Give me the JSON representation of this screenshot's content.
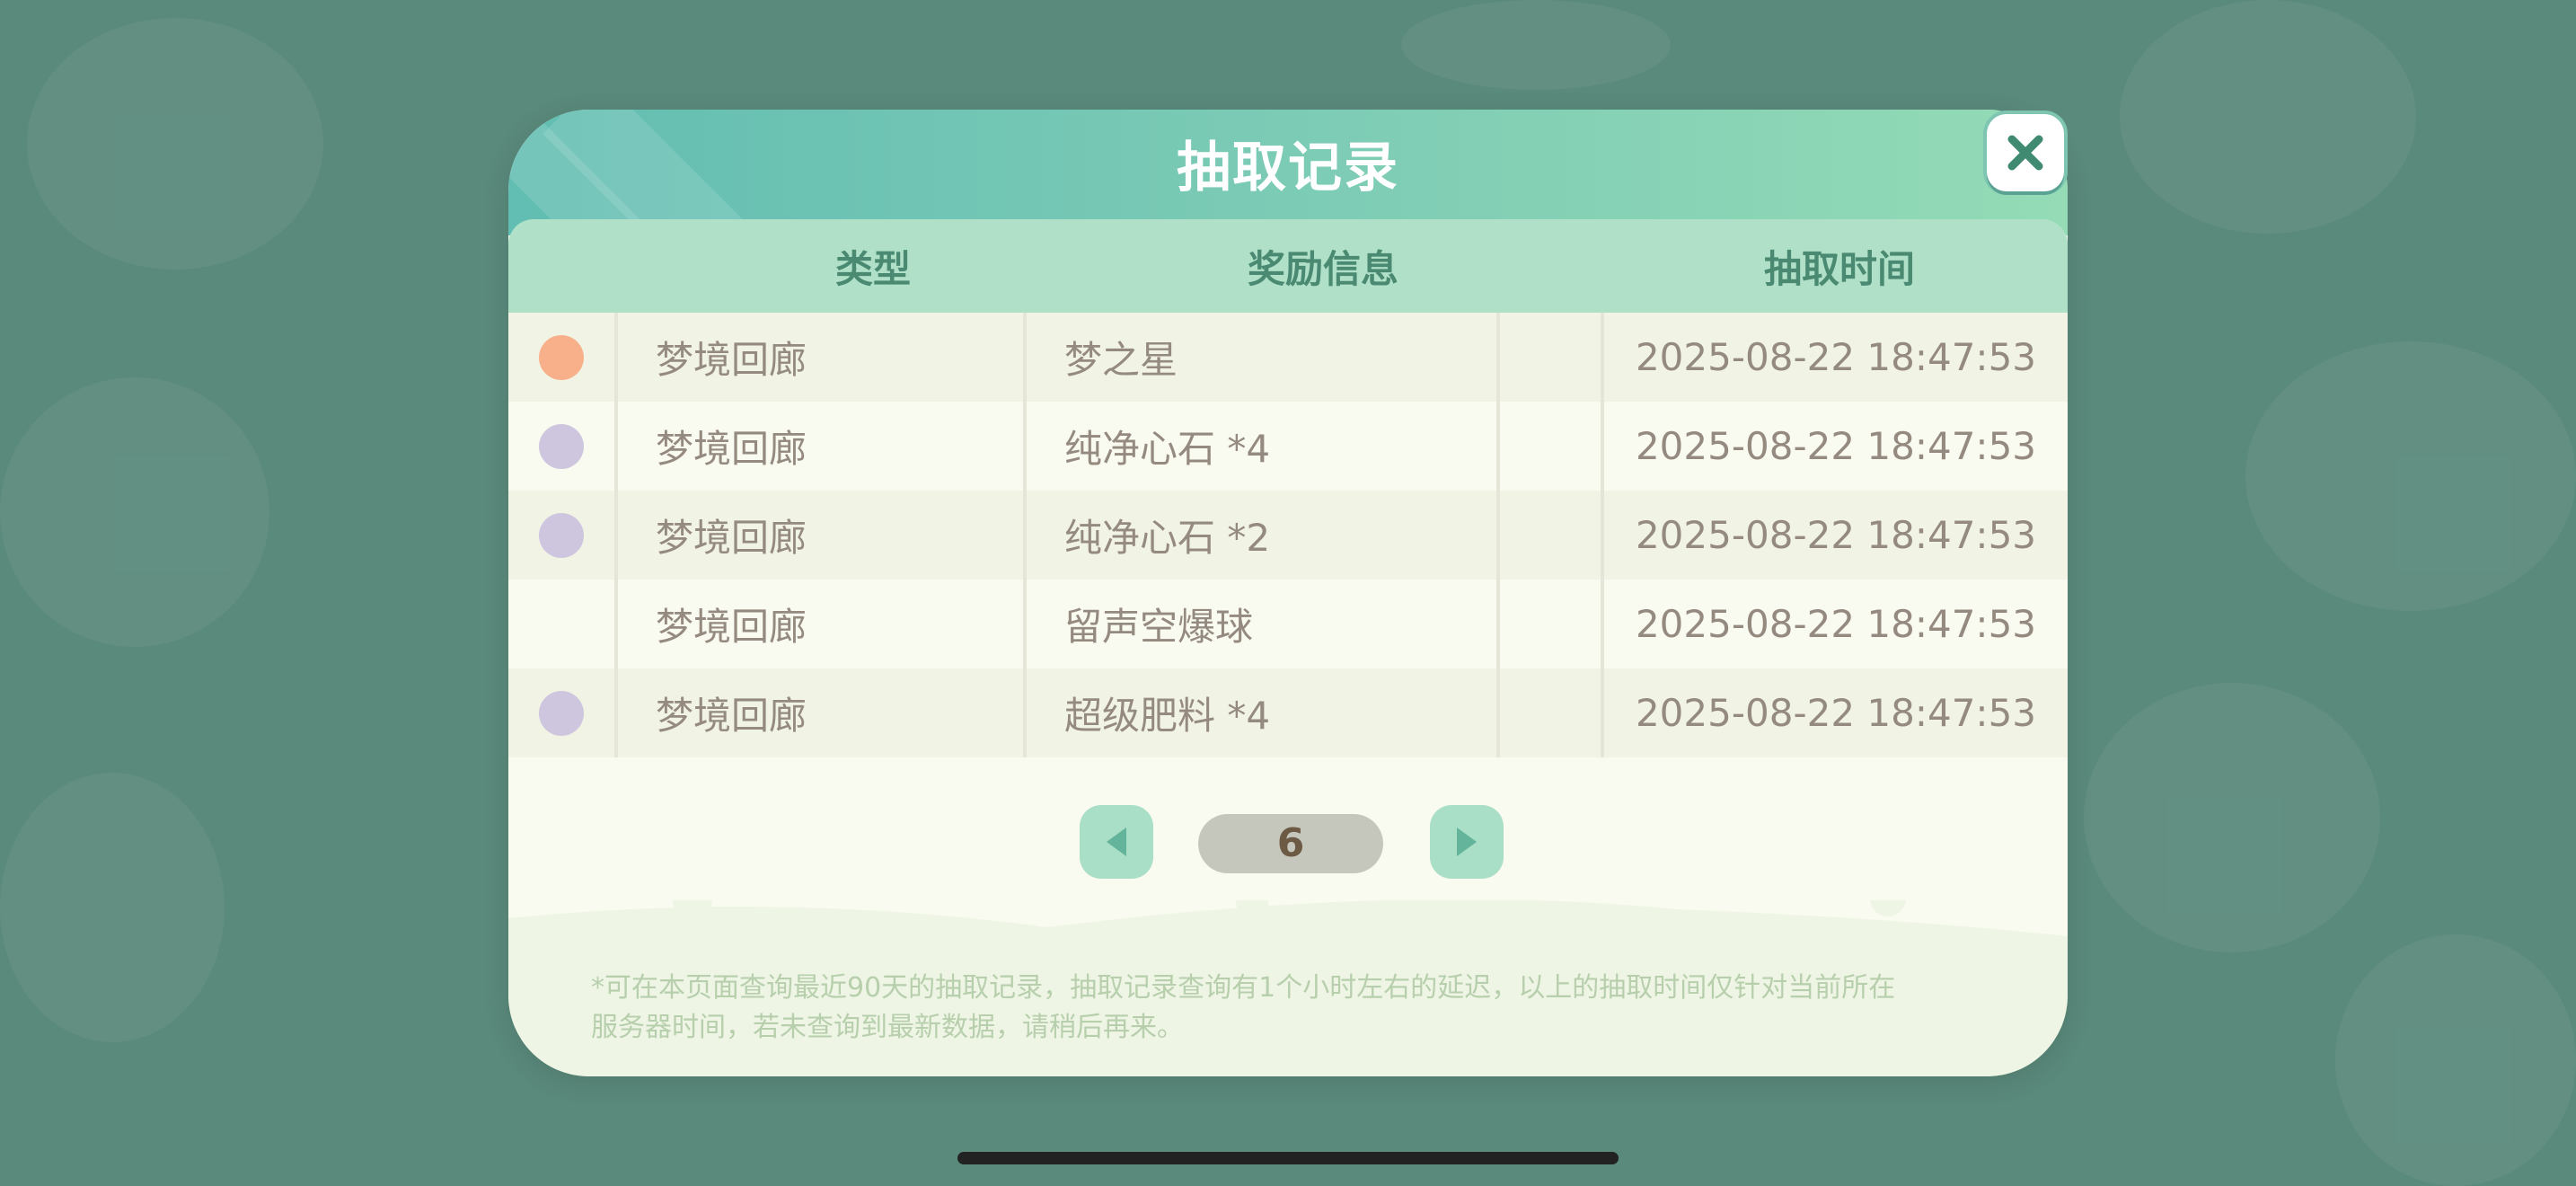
{
  "title": "抽取记录",
  "close": {
    "icon": "close-icon"
  },
  "table": {
    "headers": {
      "type": "类型",
      "reward": "奖励信息",
      "time": "抽取时间"
    },
    "rows": [
      {
        "rarity_color": "#f8b08a",
        "type": "梦境回廊",
        "reward": "梦之星",
        "time": "2025-08-22 18:47:53"
      },
      {
        "rarity_color": "#cdc6de",
        "type": "梦境回廊",
        "reward": "纯净心石 *4",
        "time": "2025-08-22 18:47:53"
      },
      {
        "rarity_color": "#cdc6de",
        "type": "梦境回廊",
        "reward": "纯净心石 *2",
        "time": "2025-08-22 18:47:53"
      },
      {
        "rarity_color": "",
        "type": "梦境回廊",
        "reward": "留声空爆球",
        "time": "2025-08-22 18:47:53"
      },
      {
        "rarity_color": "#cdc6de",
        "type": "梦境回廊",
        "reward": "超级肥料 *4",
        "time": "2025-08-22 18:47:53"
      }
    ]
  },
  "pager": {
    "page": "6",
    "prev_icon": "chevron-left-icon",
    "next_icon": "chevron-right-icon"
  },
  "footer": {
    "note_line1": "*可在本页面查询最近90天的抽取记录，抽取记录查询有1个小时左右的延迟，以上的抽取时间仅针对当前所在",
    "note_line2": "服务器时间，若未查询到最新数据，请稍后再来。"
  },
  "colors": {
    "background": "#5a8a7c",
    "header_gradient_start": "#62bdb2",
    "header_gradient_end": "#94dbb6",
    "table_header": "#b0e0c8",
    "pager_button": "#a9dfc6"
  }
}
